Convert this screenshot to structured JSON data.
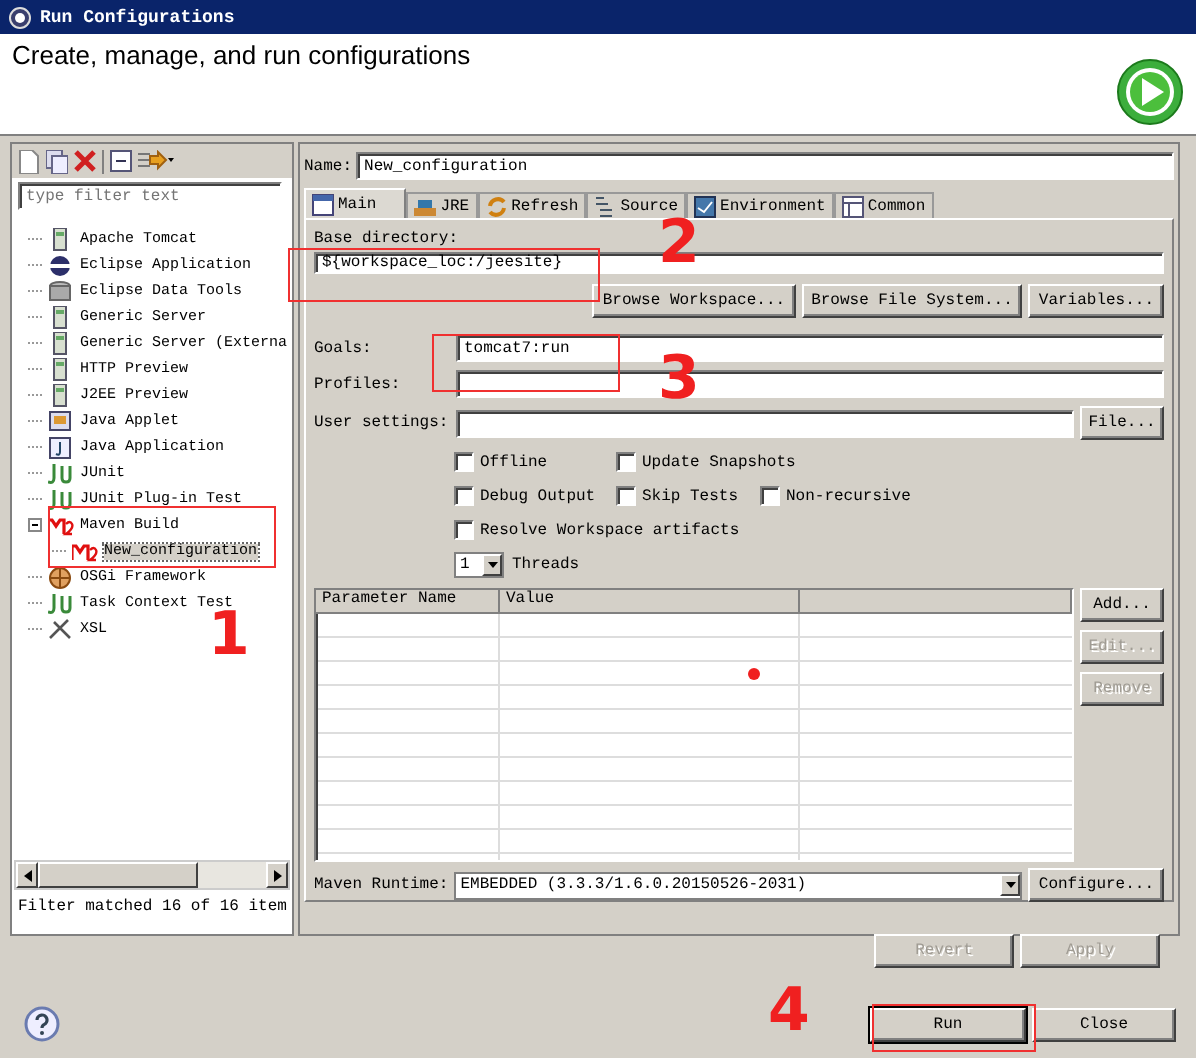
{
  "window": {
    "title": "Run Configurations"
  },
  "header": {
    "text": "Create, manage, and run configurations"
  },
  "sidebar": {
    "filter": {
      "placeholder": "type filter text"
    },
    "items": [
      {
        "label": "Apache Tomcat",
        "kind": "server",
        "selected": false
      },
      {
        "label": "Eclipse Application",
        "kind": "eclipse",
        "selected": false
      },
      {
        "label": "Eclipse Data Tools",
        "kind": "database",
        "selected": false
      },
      {
        "label": "Generic Server",
        "kind": "server",
        "selected": false
      },
      {
        "label": "Generic Server (Externa",
        "kind": "server",
        "selected": false
      },
      {
        "label": "HTTP Preview",
        "kind": "server",
        "selected": false
      },
      {
        "label": "J2EE Preview",
        "kind": "server",
        "selected": false
      },
      {
        "label": "Java Applet",
        "kind": "applet",
        "selected": false
      },
      {
        "label": "Java Application",
        "kind": "app",
        "selected": false
      },
      {
        "label": "JUnit",
        "kind": "junit",
        "selected": false
      },
      {
        "label": "JUnit Plug-in Test",
        "kind": "junit",
        "selected": false
      },
      {
        "label": "Maven Build",
        "kind": "maven",
        "selected": false,
        "expanded": true,
        "children": [
          {
            "label": "New_configuration",
            "kind": "maven",
            "selected": true
          }
        ]
      },
      {
        "label": "OSGi Framework",
        "kind": "osgi",
        "selected": false
      },
      {
        "label": "Task Context Test",
        "kind": "junit",
        "selected": false
      },
      {
        "label": "XSL",
        "kind": "xsl",
        "selected": false
      }
    ],
    "status": "Filter matched 16 of 16 item"
  },
  "editor": {
    "name_label": "Name:",
    "name": "New_configuration",
    "tabs": [
      {
        "label": "Main",
        "selected": true
      },
      {
        "label": "JRE",
        "selected": false
      },
      {
        "label": "Refresh",
        "selected": false
      },
      {
        "label": "Source",
        "selected": false
      },
      {
        "label": "Environment",
        "selected": false
      },
      {
        "label": "Common",
        "selected": false
      }
    ],
    "base_directory": {
      "label": "Base directory:",
      "value": "${workspace_loc:/jeesite}"
    },
    "base_buttons": [
      "Browse Workspace...",
      "Browse File System...",
      "Variables..."
    ],
    "goals": {
      "label": "Goals:",
      "value": "tomcat7:run"
    },
    "profiles": {
      "label": "Profiles:"
    },
    "user_settings": {
      "label": "User settings:",
      "button": "File..."
    },
    "options": [
      [
        {
          "label": "Offline",
          "checked": false
        },
        {
          "label": "Update Snapshots",
          "checked": false
        }
      ],
      [
        {
          "label": "Debug Output",
          "checked": false
        },
        {
          "label": "Skip Tests",
          "checked": false
        },
        {
          "label": "Non-recursive",
          "checked": false
        }
      ],
      [
        {
          "label": "Resolve Workspace artifacts",
          "checked": false
        }
      ]
    ],
    "threads": {
      "value": "1",
      "label": "Threads"
    },
    "table": {
      "columns": [
        "Parameter Name",
        "Value"
      ],
      "buttons": [
        {
          "label": "Add...",
          "disabled": false
        },
        {
          "label": "Edit...",
          "disabled": true
        },
        {
          "label": "Remove",
          "disabled": true
        }
      ]
    },
    "runtime": {
      "label": "Maven Runtime:",
      "value": "EMBEDDED (3.3.3/1.6.0.20150526-2031)",
      "button": "Configure..."
    },
    "actions": [
      {
        "label": "Revert",
        "disabled": true
      },
      {
        "label": "Apply",
        "disabled": true
      }
    ]
  },
  "footer": {
    "buttons": [
      {
        "label": "Run",
        "default": true
      },
      {
        "label": "Close",
        "default": false
      }
    ]
  },
  "annotations": [
    {
      "kind": "box"
    },
    {
      "kind": "box"
    },
    {
      "kind": "box"
    },
    {
      "kind": "box"
    },
    {
      "kind": "number",
      "label": "1"
    },
    {
      "kind": "number",
      "label": "2"
    },
    {
      "kind": "number",
      "label": "3"
    },
    {
      "kind": "number",
      "label": "4"
    },
    {
      "kind": "dot"
    }
  ]
}
